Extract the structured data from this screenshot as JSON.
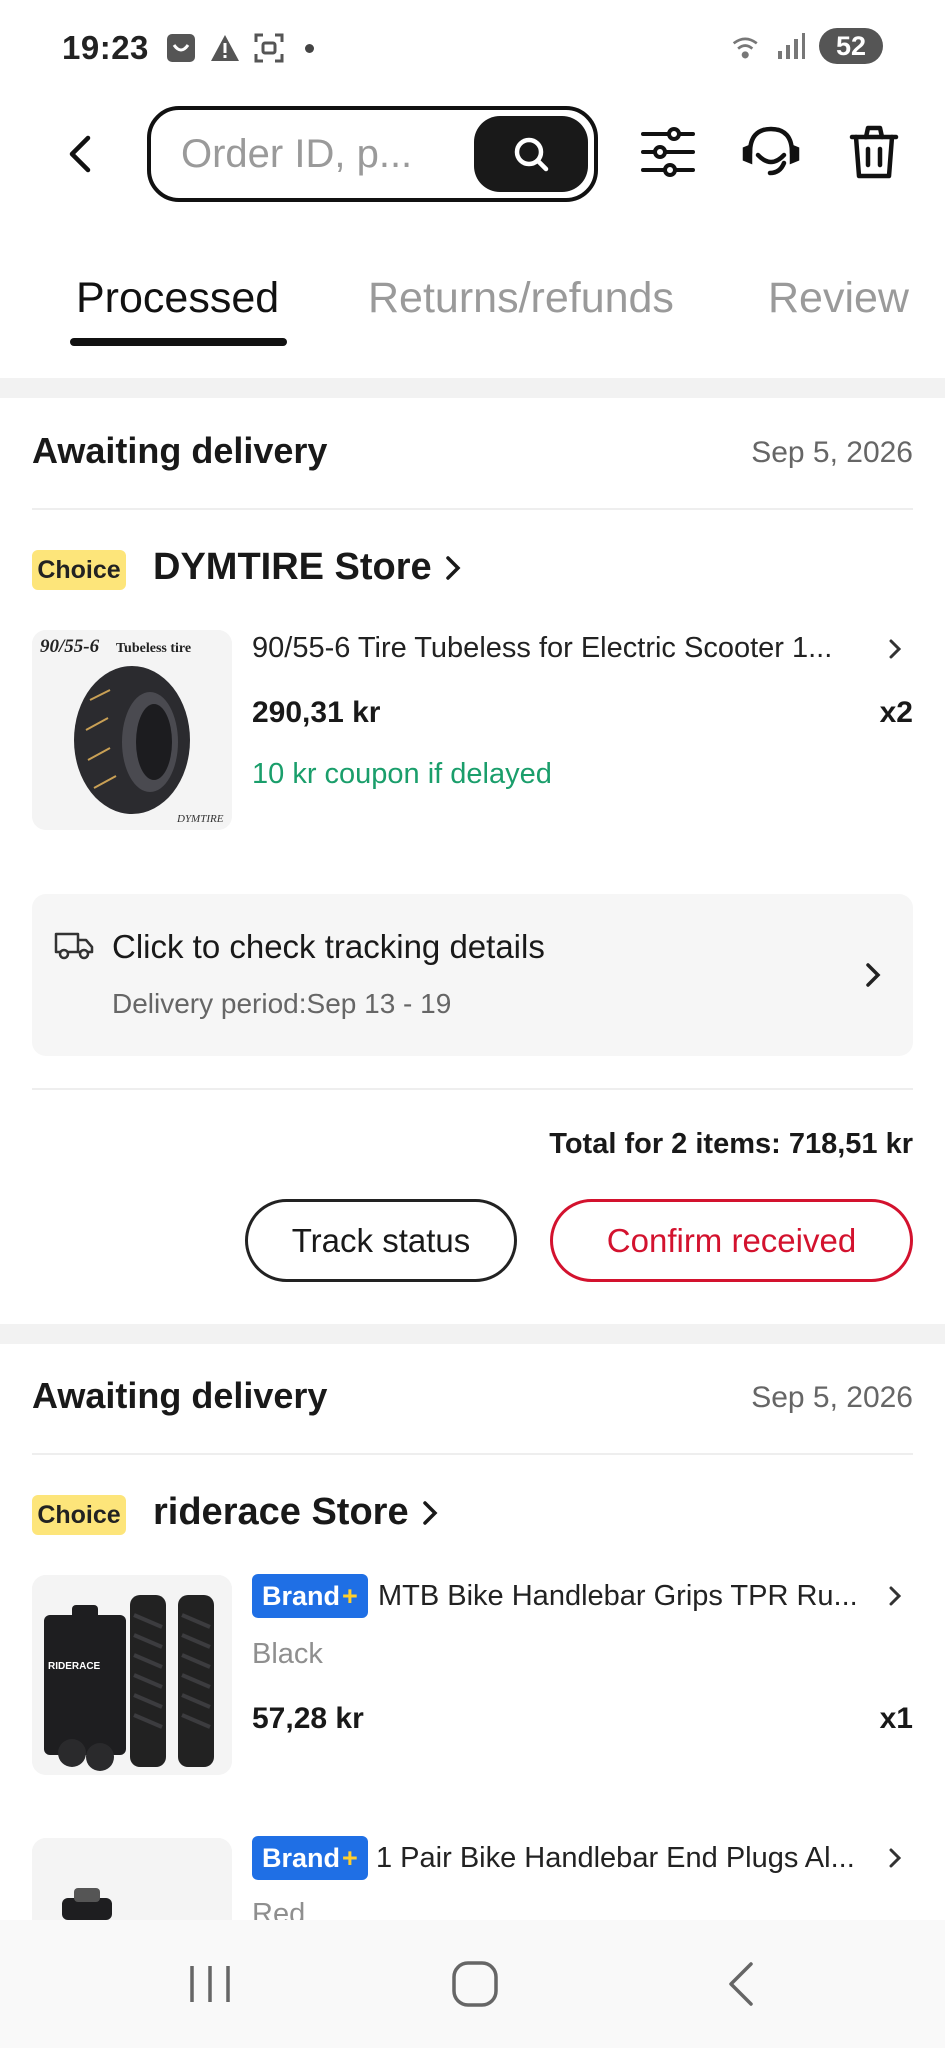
{
  "status_bar": {
    "time": "19:23",
    "left_icons": [
      "notification-icon",
      "alert-icon",
      "screenshot-icon"
    ],
    "right_icons": [
      "wifi-5g-icon",
      "signal-icon"
    ],
    "battery": "52"
  },
  "header": {
    "search_placeholder": "Order ID, p...",
    "icons": [
      "back-icon",
      "search-icon",
      "filter-icon",
      "support-icon",
      "trash-icon"
    ]
  },
  "tabs": [
    {
      "label": "Processed",
      "active": true
    },
    {
      "label": "Returns/refunds",
      "active": false
    },
    {
      "label": "Review",
      "active": false
    }
  ],
  "orders": [
    {
      "status": "Awaiting delivery",
      "date": "Sep 5, 2026",
      "badge": "Choice",
      "store": "DYMTIRE Store",
      "items": [
        {
          "thumb_label": "90/55-6",
          "thumb_caption": "Tubeless tire",
          "thumb_brand": "DYMTIRE",
          "title": "90/55-6 Tire Tubeless for Electric Scooter 1...",
          "price": "290,31 kr",
          "qty": "x2",
          "coupon": "10 kr coupon if delayed"
        }
      ],
      "tracking": {
        "title": "Click to check tracking details",
        "subtitle": "Delivery period:Sep 13 - 19"
      },
      "total": "Total for 2 items: 718,51 kr",
      "actions": {
        "track": "Track status",
        "confirm": "Confirm received"
      }
    },
    {
      "status": "Awaiting delivery",
      "date": "Sep 5, 2026",
      "badge": "Choice",
      "store": "riderace Store",
      "items": [
        {
          "brand_badge": "Brand",
          "brand_plus": "+",
          "thumb_brand": "RIDERACE",
          "title": "MTB Bike Handlebar Grips TPR Ru...",
          "variant": "Black",
          "price": "57,28 kr",
          "qty": "x1"
        },
        {
          "brand_badge": "Brand",
          "brand_plus": "+",
          "title": "1 Pair Bike Handlebar End Plugs Al...",
          "variant": "Red"
        }
      ]
    }
  ],
  "nav_bar": {
    "icons": [
      "recent-apps-icon",
      "home-icon",
      "back-nav-icon"
    ]
  },
  "colors": {
    "accent_red": "#d3122e",
    "coupon_green": "#1a9e6b",
    "choice_yellow": "#fde57a",
    "brand_blue": "#1f6fe5"
  }
}
